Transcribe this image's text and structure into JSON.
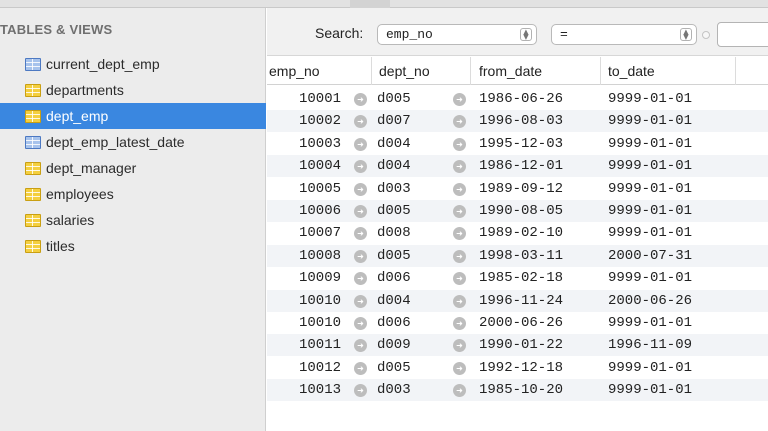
{
  "sidebar": {
    "header": "TABLES & VIEWS",
    "items": [
      {
        "label": "current_dept_emp",
        "kind": "view-icon"
      },
      {
        "label": "departments",
        "kind": "table-icon"
      },
      {
        "label": "dept_emp",
        "kind": "table-icon",
        "selected": true
      },
      {
        "label": "dept_emp_latest_date",
        "kind": "view-icon"
      },
      {
        "label": "dept_manager",
        "kind": "table-icon"
      },
      {
        "label": "employees",
        "kind": "table-icon"
      },
      {
        "label": "salaries",
        "kind": "table-icon"
      },
      {
        "label": "titles",
        "kind": "table-icon"
      }
    ]
  },
  "search": {
    "label": "Search:",
    "field": "emp_no",
    "operator": "=",
    "value": ""
  },
  "grid": {
    "columns": [
      "emp_no",
      "dept_no",
      "from_date",
      "to_date"
    ],
    "rows": [
      [
        "10001",
        "d005",
        "1986-06-26",
        "9999-01-01"
      ],
      [
        "10002",
        "d007",
        "1996-08-03",
        "9999-01-01"
      ],
      [
        "10003",
        "d004",
        "1995-12-03",
        "9999-01-01"
      ],
      [
        "10004",
        "d004",
        "1986-12-01",
        "9999-01-01"
      ],
      [
        "10005",
        "d003",
        "1989-09-12",
        "9999-01-01"
      ],
      [
        "10006",
        "d005",
        "1990-08-05",
        "9999-01-01"
      ],
      [
        "10007",
        "d008",
        "1989-02-10",
        "9999-01-01"
      ],
      [
        "10008",
        "d005",
        "1998-03-11",
        "2000-07-31"
      ],
      [
        "10009",
        "d006",
        "1985-02-18",
        "9999-01-01"
      ],
      [
        "10010",
        "d004",
        "1996-11-24",
        "2000-06-26"
      ],
      [
        "10010",
        "d006",
        "2000-06-26",
        "9999-01-01"
      ],
      [
        "10011",
        "d009",
        "1990-01-22",
        "1996-11-09"
      ],
      [
        "10012",
        "d005",
        "1992-12-18",
        "9999-01-01"
      ],
      [
        "10013",
        "d003",
        "1985-10-20",
        "9999-01-01"
      ]
    ]
  },
  "colors": {
    "selection": "#3a87e0",
    "sidebar_bg": "#ececec",
    "table_icon": "#f4cf3f",
    "view_icon": "#a7c3ec"
  }
}
